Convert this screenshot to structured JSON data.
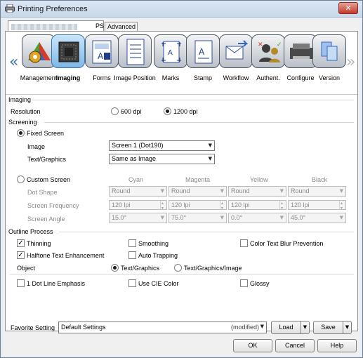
{
  "window": {
    "title": "Printing Preferences",
    "close_glyph": "✕"
  },
  "tabs": [
    {
      "label": "PS",
      "active": true
    },
    {
      "label": "Advanced",
      "active": false
    }
  ],
  "toolbar": {
    "scroll_left": "«",
    "scroll_right": "»",
    "items": [
      {
        "label": "Management",
        "icon": "management-icon"
      },
      {
        "label": "Imaging",
        "icon": "imaging-icon",
        "active": true
      },
      {
        "label": "Forms",
        "icon": "forms-icon"
      },
      {
        "label": "Image Position",
        "icon": "image-position-icon"
      },
      {
        "label": "Marks",
        "icon": "marks-icon"
      },
      {
        "label": "Stamp",
        "icon": "stamp-icon"
      },
      {
        "label": "Workflow",
        "icon": "workflow-icon"
      },
      {
        "label": "Authent.",
        "icon": "authentication-icon"
      },
      {
        "label": "Configure",
        "icon": "configure-icon"
      },
      {
        "label": "Version",
        "icon": "version-icon"
      }
    ]
  },
  "imaging": {
    "section_title": "Imaging",
    "resolution_label": "Resolution",
    "resolution_options": [
      {
        "label": "600 dpi",
        "checked": false
      },
      {
        "label": "1200 dpi",
        "checked": true
      }
    ]
  },
  "screening": {
    "section_title": "Screening",
    "fixed_screen_label": "Fixed Screen",
    "image_label": "Image",
    "image_value": "Screen 1 (Dot190)",
    "text_graphics_label": "Text/Graphics",
    "text_graphics_value": "Same as Image",
    "custom_screen_label": "Custom Screen",
    "columns": [
      "Cyan",
      "Magenta",
      "Yellow",
      "Black"
    ],
    "rows": [
      {
        "label": "Dot Shape",
        "values": [
          "Round",
          "Round",
          "Round",
          "Round"
        ]
      },
      {
        "label": "Screen Frequency",
        "values": [
          "120 lpi",
          "120 lpi",
          "120 lpi",
          "120 lpi"
        ]
      },
      {
        "label": "Screen Angle",
        "values": [
          "15.0°",
          "75.0°",
          "0.0°",
          "45.0°"
        ]
      }
    ]
  },
  "outline": {
    "section_title": "Outline Process",
    "thinning": "Thinning",
    "smoothing": "Smoothing",
    "color_text_blur": "Color Text Blur Prevention",
    "halftone_text": "Halftone Text Enhancement",
    "auto_trapping": "Auto Trapping",
    "object_label": "Object",
    "object_options": [
      {
        "label": "Text/Graphics",
        "checked": true
      },
      {
        "label": "Text/Graphics/Image",
        "checked": false
      }
    ]
  },
  "options": {
    "dot_line": "1 Dot Line Emphasis",
    "cie_color": "Use CIE Color",
    "glossy": "Glossy"
  },
  "favorite": {
    "label": "Favorite Setting",
    "value": "Default Settings",
    "status": "(modified)",
    "load": "Load",
    "save": "Save"
  },
  "footer": {
    "ok": "OK",
    "cancel": "Cancel",
    "help": "Help"
  },
  "colors": {
    "accent": "#3b78ad",
    "title_bar": "#c8d7ea",
    "close": "#c4372a"
  }
}
